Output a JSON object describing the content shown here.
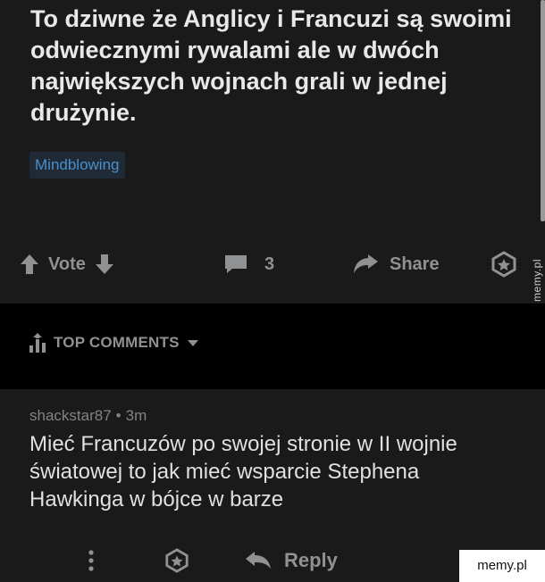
{
  "post": {
    "title": "To dziwne że Anglicy i Francuzi są swoimi odwiecznymi rywalami ale w dwóch największych wojnach grali w jednej drużynie.",
    "flair": "Mindblowing"
  },
  "actions": {
    "vote_label": "Vote",
    "comment_count": "3",
    "share_label": "Share"
  },
  "comments_header": {
    "label": "TOP COMMENTS"
  },
  "comment": {
    "author": "shackstar87",
    "separator": "•",
    "age": "3m",
    "body": "Mieć Francuzów po swojej stronie w II wojnie światowej to jak mieć wsparcie Stephena Hawkinga w bójce w barze",
    "reply_label": "Reply"
  },
  "watermarks": {
    "side": "memy.pl",
    "corner": "memy.pl"
  },
  "colors": {
    "background": "#1a1a1b",
    "band": "#000000",
    "flair_text": "#4a8fc9",
    "muted": "#8f9193"
  }
}
